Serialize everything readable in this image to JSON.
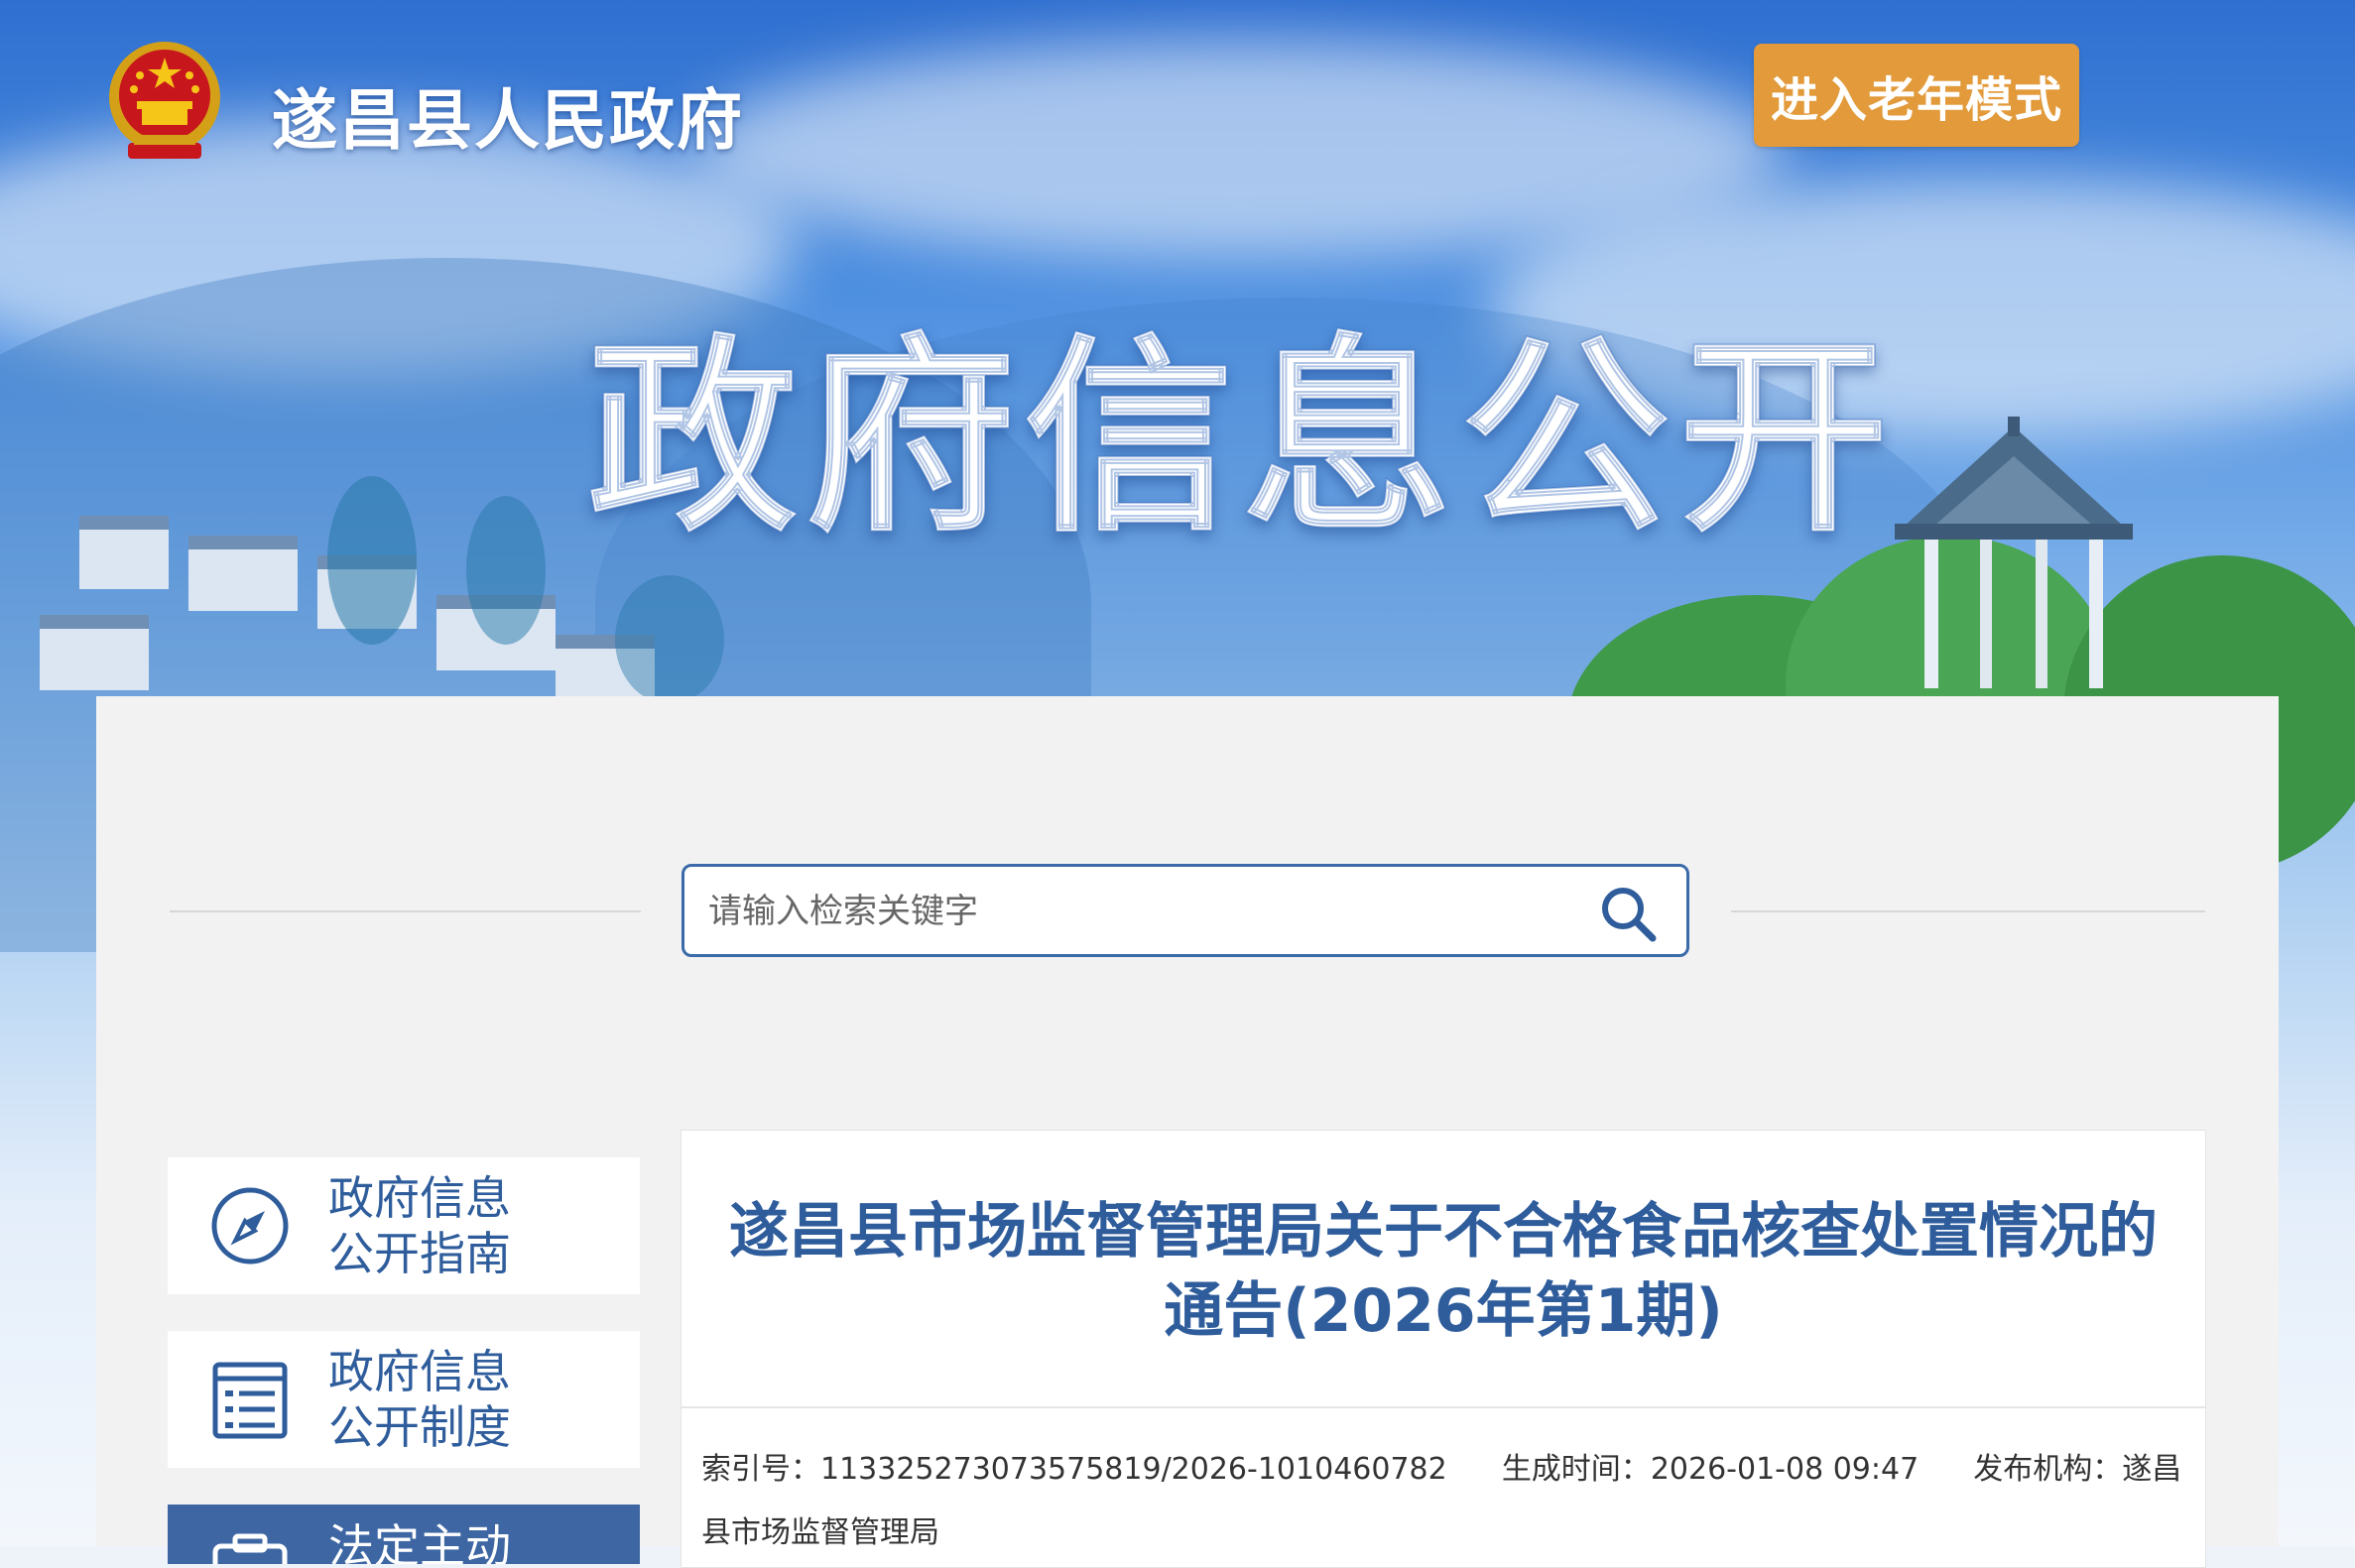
{
  "header": {
    "gov_name": "遂昌县人民政府",
    "elder_mode_label": "进入老年模式",
    "banner_title": "政府信息公开"
  },
  "search": {
    "placeholder": "请输入检索关键字"
  },
  "sidebar": {
    "items": [
      {
        "line1": "政府信息",
        "line2": "公开指南",
        "icon": "compass-icon"
      },
      {
        "line1": "政府信息",
        "line2": "公开制度",
        "icon": "document-list-icon"
      },
      {
        "line1": "法定主动",
        "icon": "folder-icon"
      }
    ]
  },
  "article": {
    "title": "遂昌县市场监督管理局关于不合格食品核查处置情况的通告(2026年第1期)",
    "index_label": "索引号：",
    "index_value": "113325273073575819/2026-1010460782",
    "created_label": "生成时间：",
    "created_value": "2026-01-08 09:47",
    "publisher_label": "发布机构：",
    "publisher_value": "遂昌县市场监督管理局"
  },
  "colors": {
    "accent_blue": "#2f5d9c",
    "elder_button": "#e29a3a",
    "sidebar_active": "#3d66a3"
  }
}
